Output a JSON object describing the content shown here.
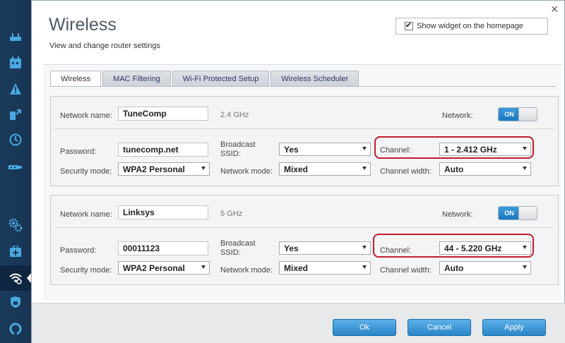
{
  "header": {
    "title": "Wireless",
    "subtitle": "View and change router settings",
    "widget_label": "Show widget on the homepage",
    "widget_checked": true
  },
  "tabs": [
    {
      "label": "Wireless",
      "active": true
    },
    {
      "label": "MAC Filtering",
      "active": false
    },
    {
      "label": "Wi-Fi Protected Setup",
      "active": false
    },
    {
      "label": "Wireless Scheduler",
      "active": false
    }
  ],
  "labels": {
    "network_name": "Network name:",
    "password": "Password:",
    "security_mode": "Security mode:",
    "broadcast_ssid_1": "Broadcast",
    "broadcast_ssid_2": "SSID:",
    "network_mode": "Network mode:",
    "channel": "Channel:",
    "channel_width": "Channel width:",
    "network": "Network:"
  },
  "networks": [
    {
      "name": "TuneComp",
      "band": "2.4 GHz",
      "network_toggle": "ON",
      "password": "tunecomp.net",
      "security_mode": "WPA2 Personal",
      "broadcast_ssid": "Yes",
      "network_mode": "Mixed",
      "channel": "1 - 2.412 GHz",
      "channel_width": "Auto"
    },
    {
      "name": "Linksys",
      "band": "5 GHz",
      "network_toggle": "ON",
      "password": "00011123",
      "security_mode": "WPA2 Personal",
      "broadcast_ssid": "Yes",
      "network_mode": "Mixed",
      "channel": "44 - 5.220 GHz",
      "channel_width": "Auto"
    }
  ],
  "buttons": {
    "ok": "Ok",
    "cancel": "Cancel",
    "apply": "Apply"
  },
  "sidebar": {
    "items": [
      "router-icon",
      "calendar-icon",
      "alert-icon",
      "devices-icon",
      "clock-icon",
      "usb-icon",
      "settings-gears-icon",
      "medical-kit-icon",
      "wifi-settings-icon",
      "shield-icon",
      "troubleshoot-icon"
    ]
  },
  "colors": {
    "highlight": "#c41d2c",
    "accent": "#2a86c8"
  }
}
